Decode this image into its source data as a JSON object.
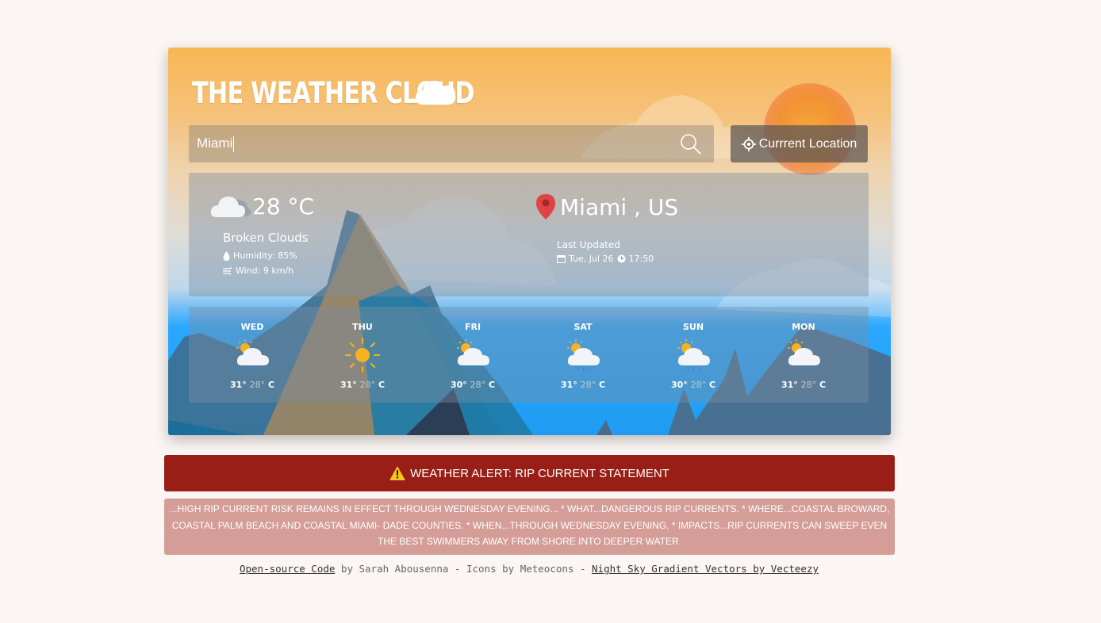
{
  "app": {
    "title": "THE WEATHER CLOUD"
  },
  "search": {
    "value": "Miami",
    "icon": "search-icon"
  },
  "location_button": {
    "label": "Currrent Location",
    "icon": "crosshair-icon"
  },
  "current": {
    "temperature": "28 °C",
    "description": "Broken Clouds",
    "humidity": "Humidity: 85%",
    "wind": "Wind: 9 km/h",
    "location": "Miami , US",
    "last_updated_label": "Last Updated",
    "date": "Tue, Jul 26",
    "time": "17:50",
    "icon": "broken-clouds-icon"
  },
  "forecast": [
    {
      "day": "WED",
      "high": "31°",
      "low": "28°",
      "unit": "C",
      "icon": "sun-cloud-rain-icon"
    },
    {
      "day": "THU",
      "high": "31°",
      "low": "28°",
      "unit": "C",
      "icon": "sun-icon"
    },
    {
      "day": "FRI",
      "high": "30°",
      "low": "28°",
      "unit": "C",
      "icon": "sun-cloud-rain-icon"
    },
    {
      "day": "SAT",
      "high": "31°",
      "low": "28°",
      "unit": "C",
      "icon": "sun-cloud-rain-icon"
    },
    {
      "day": "SUN",
      "high": "30°",
      "low": "28°",
      "unit": "C",
      "icon": "sun-cloud-rain-icon"
    },
    {
      "day": "MON",
      "high": "31°",
      "low": "28°",
      "unit": "C",
      "icon": "sun-cloud-rain-icon"
    }
  ],
  "alert": {
    "title": "WEATHER ALERT: RIP CURRENT STATEMENT",
    "body": "...HIGH RIP CURRENT RISK REMAINS IN EFFECT THROUGH WEDNESDAY EVENING... * WHAT...DANGEROUS RIP CURRENTS. * WHERE...COASTAL BROWARD, COASTAL PALM BEACH AND COASTAL MIAMI- DADE COUNTIES. * WHEN...THROUGH WEDNESDAY EVENING. * IMPACTS...RIP CURRENTS CAN SWEEP EVEN THE BEST SWIMMERS AWAY FROM SHORE INTO DEEPER WATER.",
    "color": "#981e16"
  },
  "footer": {
    "code_link": "Open-source Code",
    "by_text": " by Sarah Abousenna - Icons by Meteocons - ",
    "vectors_link": "Night Sky Gradient Vectors by Vecteezy"
  }
}
